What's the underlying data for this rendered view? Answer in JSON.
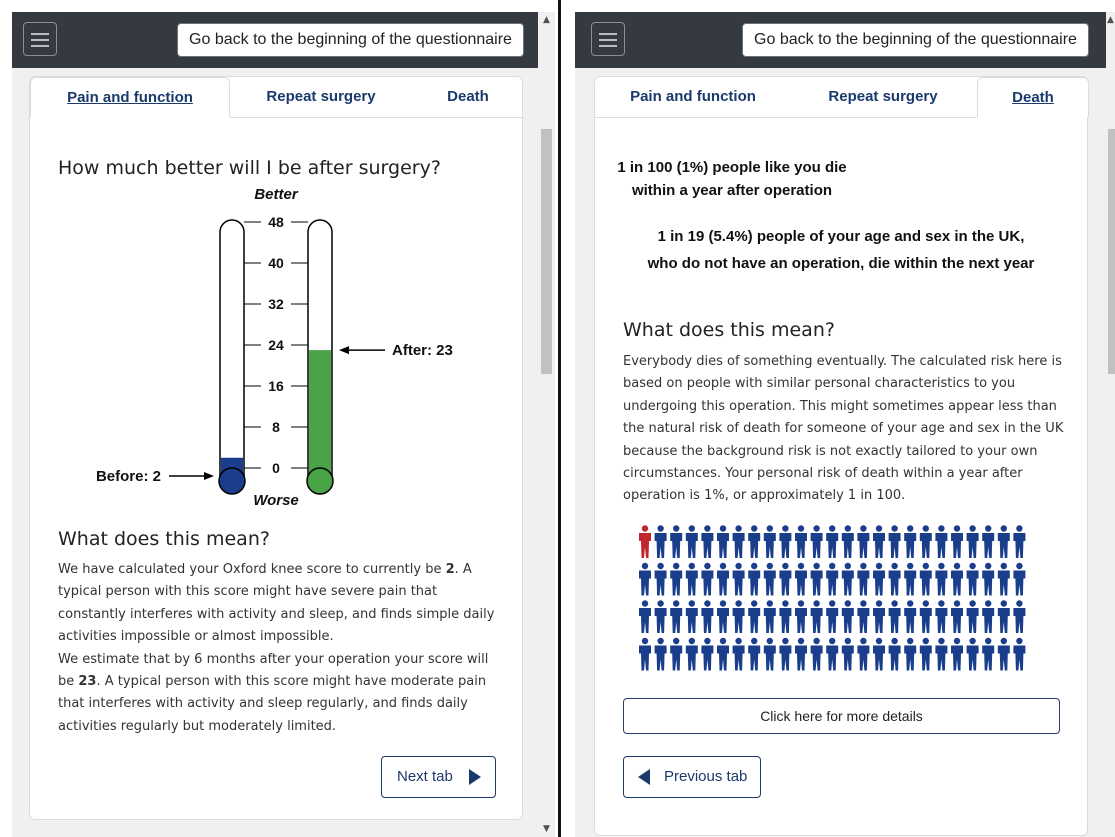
{
  "left": {
    "header": {
      "back_button": "Go back to the beginning of the questionnaire"
    },
    "tabs": [
      "Pain and function",
      "Repeat surgery",
      "Death"
    ],
    "active_tab": "Pain and function",
    "heading": "How much better will I be after surgery?",
    "thermometer": {
      "top_label": "Better",
      "bottom_label": "Worse",
      "ticks": [
        "48",
        "40",
        "32",
        "24",
        "16",
        "8",
        "0"
      ],
      "scale_max": 48,
      "before": {
        "label": "Before: 2",
        "value": 2,
        "color": "#1a3e8c"
      },
      "after": {
        "label": "After: 23",
        "value": 23,
        "color": "#4aa447"
      }
    },
    "meaning_heading": "What does this mean?",
    "paragraph1": {
      "pre": "We have calculated your Oxford knee score to currently be ",
      "bold": "2",
      "post": ". A typical person with this score might have severe pain that constantly interferes with activity and sleep, and finds simple daily activities impossible or almost impossible."
    },
    "paragraph2": {
      "pre": "We estimate that by 6 months after your operation your score will be ",
      "bold": "23",
      "post": ". A typical person with this score might have moderate pain that interferes with activity and sleep regularly, and finds daily activities regularly but moderately limited."
    },
    "next_button": "Next tab"
  },
  "right": {
    "header": {
      "back_button": "Go back to the beginning of the questionnaire"
    },
    "tabs": [
      "Pain and function",
      "Repeat surgery",
      "Death"
    ],
    "active_tab": "Death",
    "risk_line1": "1 in 100 (1%) people like you die",
    "risk_line2": "within a year after operation",
    "pop_line1": "1 in 19 (5.4%) people of your age and sex in the UK,",
    "pop_line2": "who do not have an operation, die within the next year",
    "meaning_heading": "What does this mean?",
    "meaning_text": "Everybody dies of something eventually. The calculated risk here is based on people with similar personal characteristics to you undergoing this operation. This might sometimes appear less than the natural risk of death for someone of your age and sex in the UK because the background risk is not exactly tailored to your own circumstances. Your personal risk of death within a year after operation is 1%, or approximately 1 in 100.",
    "icon_array": {
      "total": 100,
      "highlighted": 1,
      "highlight_color": "#c0262c",
      "base_color": "#1a3e8c"
    },
    "details_button": "Click here for more details",
    "prev_button": "Previous tab"
  }
}
